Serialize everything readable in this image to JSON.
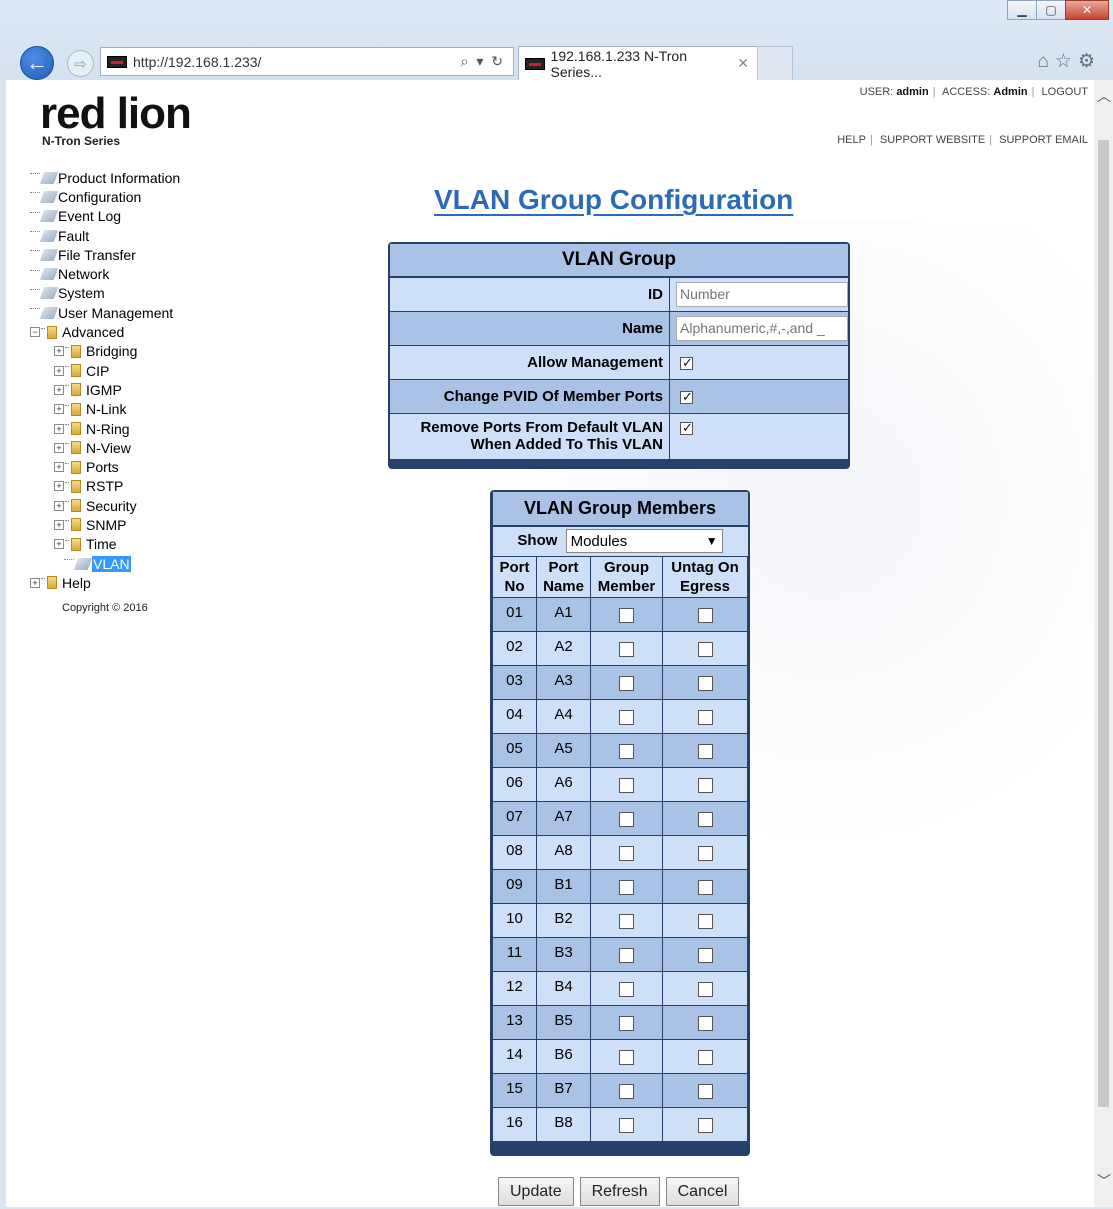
{
  "browser": {
    "url": "http://192.168.1.233/",
    "tab_title": "192.168.1.233 N-Tron Series...",
    "back_icon": "arrow-left-icon",
    "forward_icon": "arrow-right-icon"
  },
  "header": {
    "logo_text": "red lion",
    "logo_sub": "N-Tron Series",
    "user_label": "USER:",
    "user_value": "admin",
    "access_label": "ACCESS:",
    "access_value": "Admin",
    "logout": "LOGOUT",
    "help": "HELP",
    "support_website": "SUPPORT WEBSITE",
    "support_email": "SUPPORT EMAIL"
  },
  "tree": {
    "items": [
      {
        "label": "Product Information"
      },
      {
        "label": "Configuration"
      },
      {
        "label": "Event Log"
      },
      {
        "label": "Fault"
      },
      {
        "label": "File Transfer"
      },
      {
        "label": "Network"
      },
      {
        "label": "System"
      },
      {
        "label": "User Management"
      },
      {
        "label": "Advanced"
      },
      {
        "label": "Bridging"
      },
      {
        "label": "CIP"
      },
      {
        "label": "IGMP"
      },
      {
        "label": "N-Link"
      },
      {
        "label": "N-Ring"
      },
      {
        "label": "N-View"
      },
      {
        "label": "Ports"
      },
      {
        "label": "RSTP"
      },
      {
        "label": "Security"
      },
      {
        "label": "SNMP"
      },
      {
        "label": "Time"
      },
      {
        "label": "VLAN"
      },
      {
        "label": "Help"
      }
    ],
    "copyright": "Copyright © 2016"
  },
  "page": {
    "title": "VLAN Group Configuration"
  },
  "group": {
    "caption": "VLAN Group",
    "id_label": "ID",
    "id_placeholder": "Number",
    "name_label": "Name",
    "name_placeholder": "Alphanumeric,#,-,and _",
    "allow_mgmt_label": "Allow Management",
    "change_pvid_label": "Change PVID Of Member Ports",
    "remove_ports_label_1": "Remove Ports From Default VLAN",
    "remove_ports_label_2": "When Added To This VLAN"
  },
  "members": {
    "caption": "VLAN Group Members",
    "show_label": "Show",
    "show_value": "Modules",
    "col_port_no_1": "Port",
    "col_port_no_2": "No",
    "col_port_name_1": "Port",
    "col_port_name_2": "Name",
    "col_group_1": "Group",
    "col_group_2": "Member",
    "col_untag_1": "Untag On",
    "col_untag_2": "Egress",
    "rows": [
      {
        "no": "01",
        "name": "A1"
      },
      {
        "no": "02",
        "name": "A2"
      },
      {
        "no": "03",
        "name": "A3"
      },
      {
        "no": "04",
        "name": "A4"
      },
      {
        "no": "05",
        "name": "A5"
      },
      {
        "no": "06",
        "name": "A6"
      },
      {
        "no": "07",
        "name": "A7"
      },
      {
        "no": "08",
        "name": "A8"
      },
      {
        "no": "09",
        "name": "B1"
      },
      {
        "no": "10",
        "name": "B2"
      },
      {
        "no": "11",
        "name": "B3"
      },
      {
        "no": "12",
        "name": "B4"
      },
      {
        "no": "13",
        "name": "B5"
      },
      {
        "no": "14",
        "name": "B6"
      },
      {
        "no": "15",
        "name": "B7"
      },
      {
        "no": "16",
        "name": "B8"
      }
    ]
  },
  "buttons": {
    "update": "Update",
    "refresh": "Refresh",
    "cancel": "Cancel"
  }
}
